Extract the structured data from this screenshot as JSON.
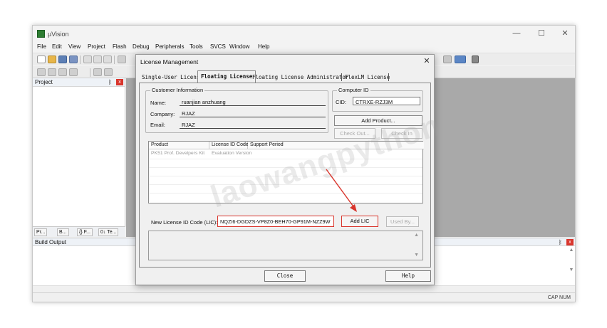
{
  "window": {
    "title": "µVision",
    "minimize": "—",
    "maximize": "☐",
    "close": "✕"
  },
  "menu": [
    "File",
    "Edit",
    "View",
    "Project",
    "Flash",
    "Debug",
    "Peripherals",
    "Tools",
    "SVCS",
    "Window",
    "Help"
  ],
  "project_panel": {
    "title": "Project",
    "pin": "ᛒ",
    "close": "x"
  },
  "project_tabs": [
    "Pr...",
    "B...",
    "{} F...",
    "0↓ Te..."
  ],
  "build_output": {
    "title": "Build Output",
    "pin": "ᛒ",
    "close": "x"
  },
  "status": {
    "indicators": "CAP  NUM"
  },
  "dialog": {
    "title": "License Management",
    "close": "✕",
    "tabs": [
      "Single-User License",
      "Floating License",
      "Floating License Administrator",
      "FlexLM License"
    ],
    "active_tab": "Floating License",
    "customer": {
      "group_label": "Customer Information",
      "name_label": "Name:",
      "name_value": "ruanjian anzhuang",
      "company_label": "Company:",
      "company_value": "RJAZ",
      "email_label": "Email:",
      "email_value": "RJAZ"
    },
    "computer": {
      "group_label": "Computer ID",
      "cid_label": "CID:",
      "cid_value": "CTRXE-RZJ3M"
    },
    "buttons": {
      "add_product": "Add Product...",
      "check_out": "Check Out...",
      "check_in": "Check In",
      "add_lic": "Add LIC",
      "used_by": "Used By...",
      "close": "Close",
      "help": "Help"
    },
    "table": {
      "columns": [
        "Product",
        "License ID Code...",
        "Support Period"
      ],
      "rows": [
        {
          "product": "PK51 Prof. Develpers Kit",
          "license_id": "Evaluation Version",
          "support": ""
        }
      ]
    },
    "lic": {
      "label": "New License ID Code (LIC):",
      "value": "NQZI6-DGDZS-VP8Z0-BEH70-GP91M-NZZ9W"
    }
  },
  "watermark": "laowangpython",
  "annotation": {
    "color": "#d9342b"
  }
}
